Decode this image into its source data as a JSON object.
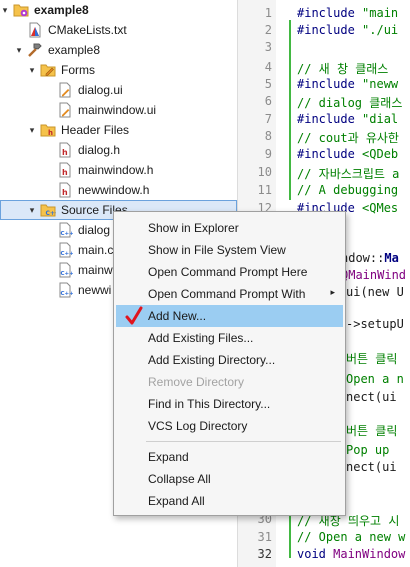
{
  "tree": [
    {
      "label": "example8",
      "icon": "cmake-project-icon",
      "arrow": "▾",
      "bold": true
    },
    {
      "label": "CMakeLists.txt",
      "icon": "cmake-file-icon",
      "arrow": "",
      "bold": false
    },
    {
      "label": "example8",
      "icon": "hammer-icon",
      "arrow": "▾",
      "bold": false
    },
    {
      "label": "Forms",
      "icon": "forms-folder-icon",
      "arrow": "▾",
      "bold": false
    },
    {
      "label": "dialog.ui",
      "icon": "ui-file-icon",
      "arrow": "",
      "bold": false
    },
    {
      "label": "mainwindow.ui",
      "icon": "ui-file-icon",
      "arrow": "",
      "bold": false
    },
    {
      "label": "Header Files",
      "icon": "header-folder-icon",
      "arrow": "▾",
      "bold": false
    },
    {
      "label": "dialog.h",
      "icon": "header-file-icon",
      "arrow": "",
      "bold": false
    },
    {
      "label": "mainwindow.h",
      "icon": "header-file-icon",
      "arrow": "",
      "bold": false
    },
    {
      "label": "newwindow.h",
      "icon": "header-file-icon",
      "arrow": "",
      "bold": false
    },
    {
      "label": "Source Files",
      "icon": "source-folder-icon",
      "arrow": "▾",
      "bold": false
    },
    {
      "label": "dialog",
      "icon": "cpp-file-icon",
      "arrow": "",
      "bold": false
    },
    {
      "label": "main.c",
      "icon": "cpp-file-icon",
      "arrow": "",
      "bold": false
    },
    {
      "label": "mainw",
      "icon": "cpp-file-icon",
      "arrow": "",
      "bold": false
    },
    {
      "label": "newwi",
      "icon": "cpp-file-icon",
      "arrow": "",
      "bold": false
    }
  ],
  "editor": {
    "line_numbers": [
      "1",
      "2",
      "3",
      "4",
      "5",
      "6",
      "7",
      "8",
      "9",
      "10",
      "11",
      "12",
      "30",
      "31",
      "32"
    ],
    "current_line": "32",
    "lines": [
      [
        {
          "t": "#include ",
          "c": "navy"
        },
        {
          "t": "\"main",
          "c": "green"
        }
      ],
      [
        {
          "t": "#include ",
          "c": "navy"
        },
        {
          "t": "\"./ui",
          "c": "green"
        }
      ],
      [],
      [
        {
          "t": "// 새 창 클래스",
          "c": "comment"
        }
      ],
      [
        {
          "t": "#include ",
          "c": "navy"
        },
        {
          "t": "\"neww",
          "c": "green"
        }
      ],
      [
        {
          "t": "// dialog 클래스",
          "c": "comment"
        }
      ],
      [
        {
          "t": "#include ",
          "c": "navy"
        },
        {
          "t": "\"dial",
          "c": "green"
        }
      ],
      [
        {
          "t": "// cout과 유사한",
          "c": "comment"
        }
      ],
      [
        {
          "t": "#include ",
          "c": "navy"
        },
        {
          "t": "<QDeb",
          "c": "green"
        }
      ],
      [
        {
          "t": "// 자바스크립트 a",
          "c": "comment"
        }
      ],
      [
        {
          "t": "// A debugging",
          "c": "comment"
        }
      ],
      [
        {
          "t": "#include ",
          "c": "navy"
        },
        {
          "t": "<QMes",
          "c": "green"
        }
      ],
      [
        {
          "t": "ndow::",
          "c": "dark"
        },
        {
          "t": "Ma",
          "c": "boldnavy"
        }
      ],
      [
        {
          "t": "QMainWind",
          "c": "purple"
        }
      ],
      [
        {
          "t": "ui",
          "c": "dark"
        },
        {
          "t": "(new U",
          "c": "dark"
        }
      ],
      [
        {
          "t": "->setupU",
          "c": "dark"
        }
      ],
      [
        {
          "t": "버튼 클릭",
          "c": "comment"
        }
      ],
      [
        {
          "t": "Open a n",
          "c": "comment"
        }
      ],
      [
        {
          "t": "nect",
          "c": "dark"
        },
        {
          "t": "(ui",
          "c": "dark"
        }
      ],
      [
        {
          "t": "버튼 클릭",
          "c": "comment"
        }
      ],
      [
        {
          "t": "Pop up",
          "c": "comment"
        }
      ],
      [
        {
          "t": "nect",
          "c": "dark"
        },
        {
          "t": "(ui",
          "c": "dark"
        }
      ],
      [
        {
          "t": "// 새창 띄우고 시",
          "c": "comment"
        }
      ],
      [
        {
          "t": "// Open a new w",
          "c": "comment"
        }
      ],
      [
        {
          "t": "void ",
          "c": "navy"
        },
        {
          "t": "MainWindow",
          "c": "purple"
        }
      ]
    ]
  },
  "menu": {
    "items": [
      {
        "label": "Show in Explorer",
        "state": "normal",
        "sub": false,
        "sep_after": false
      },
      {
        "label": "Show in File System View",
        "state": "normal",
        "sub": false,
        "sep_after": false
      },
      {
        "label": "Open Command Prompt Here",
        "state": "normal",
        "sub": false,
        "sep_after": false
      },
      {
        "label": "Open Command Prompt With",
        "state": "normal",
        "sub": true,
        "sep_after": false
      },
      {
        "label": "Add New...",
        "state": "highlighted",
        "sub": false,
        "sep_after": false
      },
      {
        "label": "Add Existing Files...",
        "state": "normal",
        "sub": false,
        "sep_after": false
      },
      {
        "label": "Add Existing Directory...",
        "state": "normal",
        "sub": false,
        "sep_after": false
      },
      {
        "label": "Remove Directory",
        "state": "disabled",
        "sub": false,
        "sep_after": false
      },
      {
        "label": "Find in This Directory...",
        "state": "normal",
        "sub": false,
        "sep_after": false
      },
      {
        "label": "VCS Log Directory",
        "state": "normal",
        "sub": false,
        "sep_after": true
      },
      {
        "label": "Expand",
        "state": "normal",
        "sub": false,
        "sep_after": false
      },
      {
        "label": "Collapse All",
        "state": "normal",
        "sub": false,
        "sep_after": false
      },
      {
        "label": "Expand All",
        "state": "normal",
        "sub": false,
        "sep_after": false
      }
    ],
    "submenu_arrow": "▸",
    "annotation": "red-checkmark"
  },
  "colors": {
    "navy": "#000080",
    "green": "#008000",
    "comment": "#008000",
    "purple": "#800080",
    "dark": "#1a1a1a",
    "boldnavy": "#000080",
    "selection": "#dbe8f8",
    "menu_highlight": "#9bcdf2",
    "checkmark": "#e0141e"
  }
}
